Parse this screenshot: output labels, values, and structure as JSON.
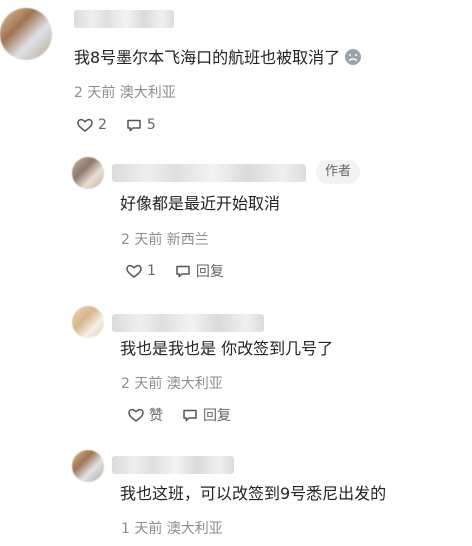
{
  "comments": [
    {
      "text": "我8号墨尔本飞海口的航班也被取消了",
      "meta": "2 天前 澳大利亚",
      "actions": {
        "like_count": "2",
        "reply_count": "5"
      }
    },
    {
      "author_badge": "作者",
      "text": "好像都是最近开始取消",
      "meta": "2 天前 新西兰",
      "actions": {
        "like_count": "1",
        "reply_label": "回复"
      }
    },
    {
      "text": "我也是我也是 你改签到几号了",
      "meta": "2 天前 澳大利亚",
      "actions": {
        "like_label": "赞",
        "reply_label": "回复"
      }
    },
    {
      "text": "我也这班，可以改签到9号悉尼出发的",
      "meta": "1 天前 澳大利亚"
    }
  ],
  "icons": {
    "like": "heart-outline-icon",
    "reply": "speech-bubble-icon",
    "reaction": "sad-face-emoji-icon"
  }
}
